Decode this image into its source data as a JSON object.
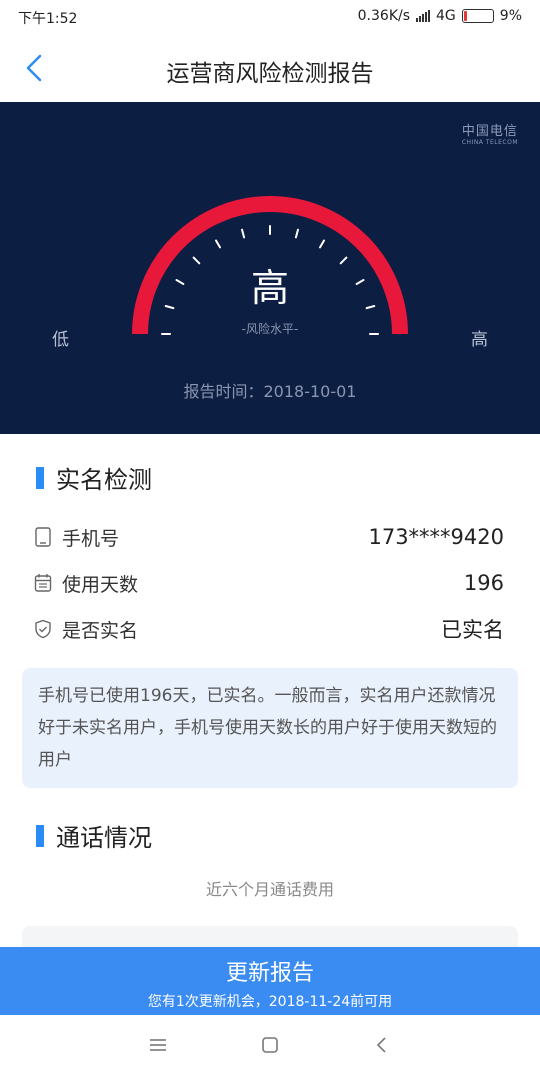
{
  "status": {
    "time": "下午1:52",
    "speed": "0.36K/s",
    "network": "4G",
    "battery": "9%"
  },
  "nav": {
    "title": "运营商风险检测报告"
  },
  "hero": {
    "carrier_logo": "中国电信",
    "carrier_logo_en": "CHINA TELECOM",
    "level": "高",
    "caption": "-风险水平-",
    "low_label": "低",
    "high_label": "高",
    "report_time": "报告时间：2018-10-01",
    "gauge_color": "#e8183a"
  },
  "realname": {
    "title": "实名检测",
    "rows": [
      {
        "icon": "phone-icon",
        "label": "手机号",
        "value": "173****9420"
      },
      {
        "icon": "calendar-icon",
        "label": "使用天数",
        "value": "196"
      },
      {
        "icon": "shield-check-icon",
        "label": "是否实名",
        "value": "已实名"
      }
    ],
    "note": "手机号已使用196天，已实名。一般而言，实名用户还款情况好于未实名用户，手机号使用天数长的用户好于使用天数短的用户"
  },
  "calls": {
    "title": "通话情况",
    "subtitle": "近六个月通话费用"
  },
  "cta": {
    "label": "更新报告",
    "sub": "您有1次更新机会，2018-11-24前可用"
  },
  "colors": {
    "accent": "#3a8cf3",
    "hero_bg": "#0d1e43"
  }
}
